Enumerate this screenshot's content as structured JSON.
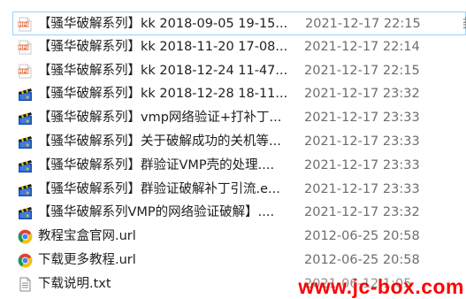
{
  "files": [
    {
      "name": "【骚华破解系列】kk 2018-09-05 19-15...",
      "date": "2021-12-17 22:15",
      "icon": "mp4-icon",
      "selected": true
    },
    {
      "name": "【骚华破解系列】kk 2018-11-20 17-08...",
      "date": "2021-12-17 22:14",
      "icon": "mp4-icon"
    },
    {
      "name": "【骚华破解系列】kk 2018-12-24 11-47...",
      "date": "2021-12-17 22:15",
      "icon": "mp4-icon"
    },
    {
      "name": "【骚华破解系列】kk 2018-12-28 18-11...",
      "date": "2021-12-17 23:32",
      "icon": "video-clapper-icon"
    },
    {
      "name": "【骚华破解系列】vmp网络验证+打补丁...",
      "date": "2021-12-17 23:33",
      "icon": "video-clapper-icon"
    },
    {
      "name": "【骚华破解系列】关于破解成功的关机等...",
      "date": "2021-12-17 23:33",
      "icon": "video-clapper-icon"
    },
    {
      "name": "【骚华破解系列】群验证VMP壳的处理....",
      "date": "2021-12-17 23:33",
      "icon": "video-clapper-icon"
    },
    {
      "name": "【骚华破解系列】群验证破解补丁引流.e...",
      "date": "2021-12-17 23:33",
      "icon": "video-clapper-icon"
    },
    {
      "name": "【骚华破解系列VMP的网络验证破解】....",
      "date": "2021-12-17 23:32",
      "icon": "video-clapper-icon"
    },
    {
      "name": "教程宝盒官网.url",
      "date": "2012-06-25 20:58",
      "icon": "chrome-icon"
    },
    {
      "name": "下载更多教程.url",
      "date": "2012-06-25 20:58",
      "icon": "chrome-icon"
    },
    {
      "name": "下载说明.txt",
      "date": "2021-06-12 1:05",
      "icon": "text-file-icon"
    }
  ],
  "watermark": "www.jc-box.com",
  "colors": {
    "selection_border": "#99d1ff",
    "date_text": "#6d6d6d",
    "name_text": "#1e1e1e",
    "watermark": "#ff0000"
  }
}
